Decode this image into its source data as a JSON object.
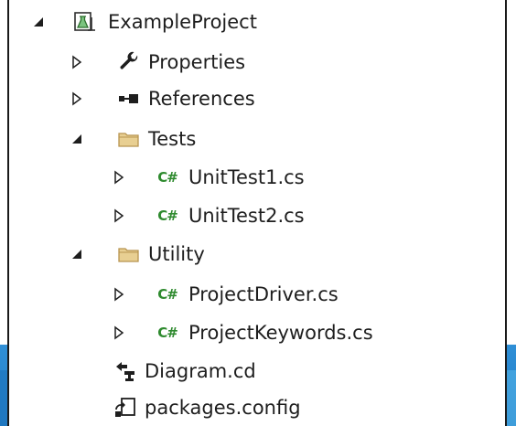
{
  "tree": {
    "project": {
      "label": "ExampleProject",
      "expanded": true,
      "icon": "test-project-icon"
    },
    "items": [
      {
        "key": "properties",
        "label": "Properties",
        "icon": "wrench-icon",
        "expanded": false
      },
      {
        "key": "references",
        "label": "References",
        "icon": "references-icon",
        "expanded": false
      },
      {
        "key": "tests",
        "label": "Tests",
        "icon": "folder-icon",
        "expanded": true,
        "children": [
          {
            "key": "unittest1",
            "label": "UnitTest1.cs",
            "icon": "csharp-file-icon",
            "expanded": false
          },
          {
            "key": "unittest2",
            "label": "UnitTest2.cs",
            "icon": "csharp-file-icon",
            "expanded": false
          }
        ]
      },
      {
        "key": "utility",
        "label": "Utility",
        "icon": "folder-icon",
        "expanded": true,
        "children": [
          {
            "key": "projectdriver",
            "label": "ProjectDriver.cs",
            "icon": "csharp-file-icon",
            "expanded": false
          },
          {
            "key": "projectkeywords",
            "label": "ProjectKeywords.cs",
            "icon": "csharp-file-icon",
            "expanded": false
          }
        ]
      },
      {
        "key": "diagram",
        "label": "Diagram.cd",
        "icon": "class-diagram-icon"
      },
      {
        "key": "packages",
        "label": "packages.config",
        "icon": "config-file-icon"
      }
    ]
  },
  "icons": {
    "csharp_glyph": "C#"
  },
  "colors": {
    "csharp_green": "#2e8a2e",
    "folder_yellow": "#dcb67a",
    "text": "#1e1e1e",
    "band_blue": "#1f7cc7"
  }
}
